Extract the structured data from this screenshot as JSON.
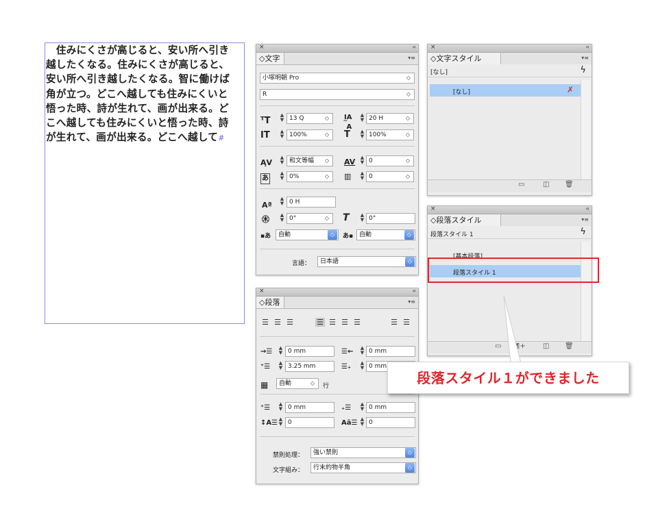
{
  "text_frame": {
    "lines": [
      "　住みにくさが高じると、安い所へ引き",
      "越したくなる。住みにくさが高じると、",
      "安い所へ引き越したくなる。智に働けば",
      "角が立つ。どこへ越しても住みにくいと",
      "悟った時、詩が生れて、画が出来る。ど",
      "こへ越しても住みにくいと悟った時、詩",
      "が生れて、画が出来る。どこへ越して"
    ],
    "end_mark": "#"
  },
  "char_panel": {
    "close": "×",
    "collapse": "‹‹",
    "tab": "◇文字",
    "menu": "▾≡",
    "font_family": "小塚明朝 Pro",
    "font_style": "R",
    "font_size": "13 Q",
    "leading": "20 H",
    "vertical_scale": "100%",
    "horizontal_scale": "100%",
    "tracking_mode": "和文等幅",
    "tracking": "0",
    "tsume": "0%",
    "kerning": "0",
    "baseline_shift": "0 H",
    "rotation": "0°",
    "skew": "0°",
    "aki_before": "自動",
    "aki_after": "自動",
    "language_label": "言語：",
    "language": "日本語"
  },
  "para_panel": {
    "close": "×",
    "collapse": "‹‹",
    "tab": "◇段落",
    "menu": "▾≡",
    "left_indent": "0 mm",
    "right_indent": "0 mm",
    "first_line_indent": "3.25 mm",
    "last_line_indent": "0 mm",
    "grid_value": "自動",
    "grid_unit": "行",
    "space_before": "0 mm",
    "space_after": "0 mm",
    "drop_lines": "0",
    "drop_chars": "0",
    "kinsoku_label": "禁則処理：",
    "kinsoku": "強い禁則",
    "mojikumi_label": "文字組み：",
    "mojikumi": "行末約物半角"
  },
  "char_style_panel": {
    "close": "×",
    "collapse": "‹‹",
    "tab": "◇文字スタイル",
    "menu": "▾≡",
    "current": "[なし]",
    "items": [
      "[なし]"
    ]
  },
  "para_style_panel": {
    "close": "×",
    "collapse": "‹‹",
    "tab": "◇段落スタイル",
    "menu": "▾≡",
    "current": "段落スタイル 1",
    "items": [
      "[基本段落]",
      "段落スタイル 1"
    ]
  },
  "callout": {
    "text": "段落スタイル１ができました"
  },
  "colors": {
    "highlight": "#e0252b",
    "selection": "#a9cdf5",
    "frame_border": "#8a8ad8"
  }
}
